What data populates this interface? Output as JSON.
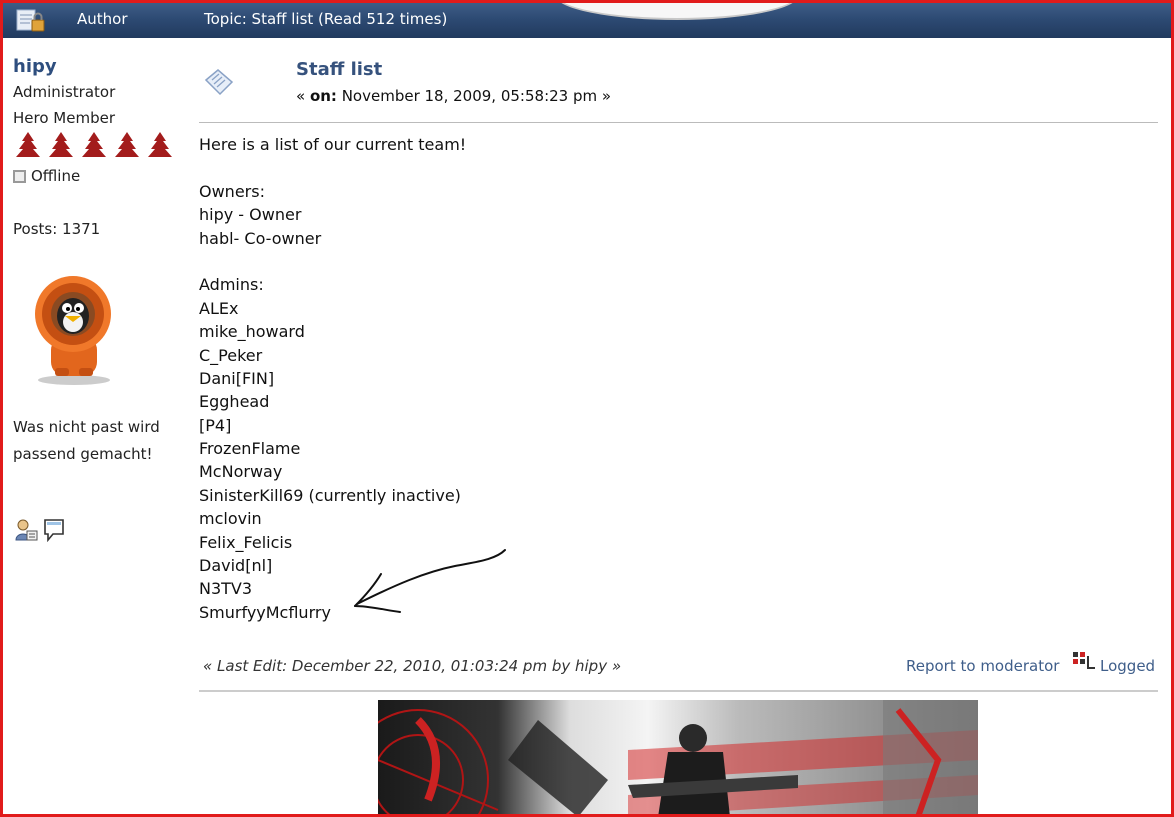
{
  "header": {
    "author_label": "Author",
    "topic_label": "Topic: Staff list  (Read 512 times)"
  },
  "poster": {
    "username": "hipy",
    "group": "Administrator",
    "rank": "Hero Member",
    "stars_count": 5,
    "status": "Offline",
    "posts": "Posts: 1371",
    "signature_line1": "Was nicht past wird",
    "signature_line2": "passend gemacht!",
    "icons": [
      "profile-icon",
      "pm-icon"
    ]
  },
  "post": {
    "subject": "Staff list",
    "date_prefix": "« ",
    "date_on": "on:",
    "date_value": " November 18, 2009, 05:58:23 pm »",
    "body_lines": [
      "Here is a list of our current team!",
      "",
      "Owners:",
      "hipy - Owner",
      "habl- Co-owner",
      "",
      "Admins:",
      "ALEx",
      "mike_howard",
      "C_Peker",
      "Dani[FIN]",
      "Egghead",
      "[P4]",
      "FrozenFlame",
      "McNorway",
      "SinisterKill69 (currently inactive)",
      "mclovin",
      "Felix_Felicis",
      "David[nl]",
      "N3TV3",
      "SmurfyyMcflurry"
    ],
    "last_edit": "« Last Edit: December 22, 2010, 01:03:24 pm by hipy »",
    "report": "Report to moderator",
    "logged": "Logged"
  },
  "colors": {
    "header_bg": "#2d4a73",
    "link": "#3f5e8a",
    "frame": "#e11b1b",
    "star": "#a31c1c"
  }
}
